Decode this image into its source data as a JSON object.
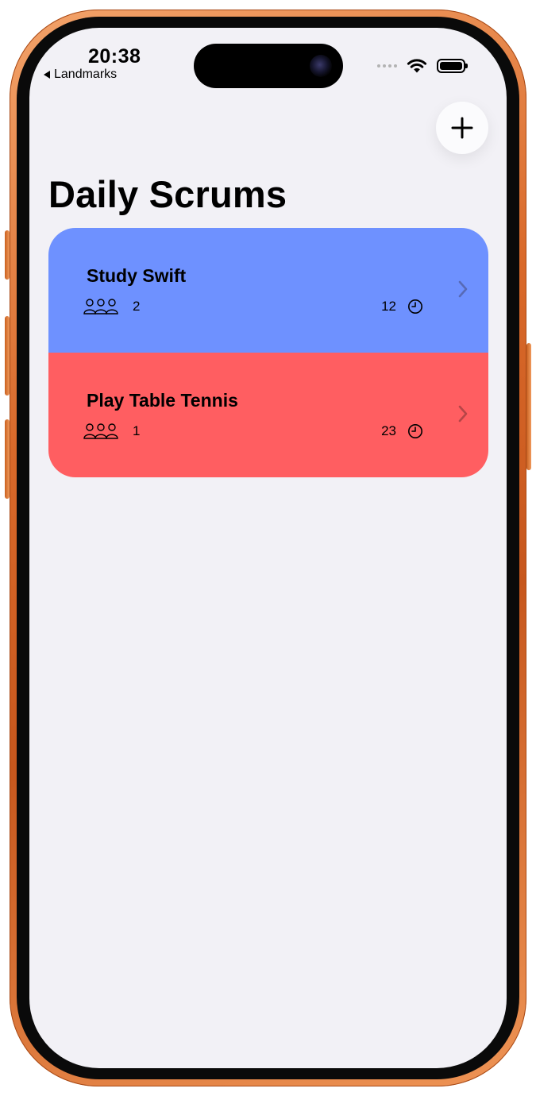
{
  "status_bar": {
    "time": "20:38",
    "back_label": "Landmarks"
  },
  "navigation": {
    "title": "Daily Scrums",
    "add_icon": "plus-icon"
  },
  "scrums": [
    {
      "title": "Study Swift",
      "attendees": "2",
      "minutes": "12",
      "color": "#6e91ff"
    },
    {
      "title": "Play Table Tennis",
      "attendees": "1",
      "minutes": "23",
      "color": "#ff5e61"
    }
  ],
  "icons": {
    "attendees": "person-3-icon",
    "duration": "clock-icon",
    "disclosure": "chevron-right-icon"
  },
  "colors": {
    "background": "#f2f1f6",
    "frame": "#d9692a"
  }
}
